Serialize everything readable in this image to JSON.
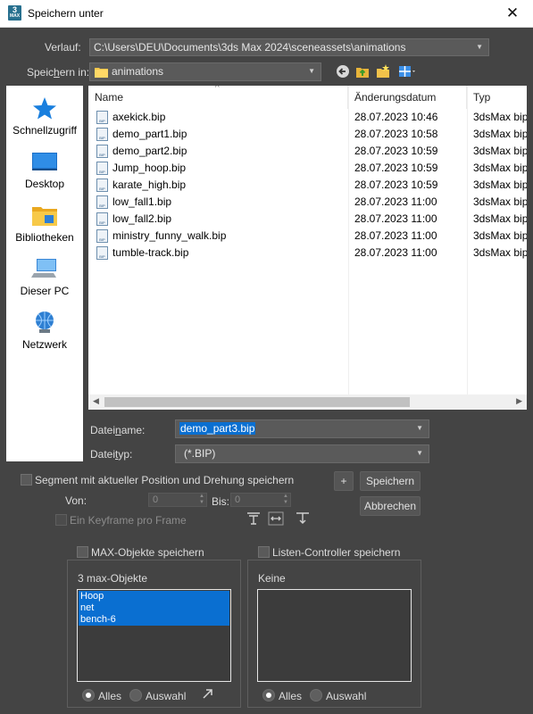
{
  "window": {
    "title": "Speichern unter",
    "app_icon": "3ds-max-icon"
  },
  "history": {
    "label": "Verlauf:",
    "value": "C:\\Users\\DEU\\Documents\\3ds Max 2024\\sceneassets\\animations"
  },
  "save_in": {
    "label_pre": "Speic",
    "label_u": "h",
    "label_post": "ern in:",
    "value": "animations"
  },
  "places": [
    "Schnellzugriff",
    "Desktop",
    "Bibliotheken",
    "Dieser PC",
    "Netzwerk"
  ],
  "columns": {
    "name": "Name",
    "date": "Änderungsdatum",
    "type": "Typ"
  },
  "files": [
    {
      "name": "axekick.bip",
      "date": "28.07.2023 10:46",
      "type": "3dsMax bip"
    },
    {
      "name": "demo_part1.bip",
      "date": "28.07.2023 10:58",
      "type": "3dsMax bip"
    },
    {
      "name": "demo_part2.bip",
      "date": "28.07.2023 10:59",
      "type": "3dsMax bip"
    },
    {
      "name": "Jump_hoop.bip",
      "date": "28.07.2023 10:59",
      "type": "3dsMax bip"
    },
    {
      "name": "karate_high.bip",
      "date": "28.07.2023 10:59",
      "type": "3dsMax bip"
    },
    {
      "name": "low_fall1.bip",
      "date": "28.07.2023 11:00",
      "type": "3dsMax bip"
    },
    {
      "name": "low_fall2.bip",
      "date": "28.07.2023 11:00",
      "type": "3dsMax bip"
    },
    {
      "name": "ministry_funny_walk.bip",
      "date": "28.07.2023 11:00",
      "type": "3dsMax bip"
    },
    {
      "name": "tumble-track.bip",
      "date": "28.07.2023 11:00",
      "type": "3dsMax bip"
    }
  ],
  "filename": {
    "label_pre": "Datei",
    "label_u": "n",
    "label_post": "ame:",
    "value": "demo_part3.bip"
  },
  "filetype": {
    "label_pre": "Datei",
    "label_u": "t",
    "label_post": "yp:",
    "value": "(*.BIP)"
  },
  "segment_checkbox": "Segment mit aktueller Position und Drehung speichern",
  "from": {
    "label": "Von:",
    "value": "0"
  },
  "to": {
    "label": "Bis:",
    "value": "0"
  },
  "keyframe_checkbox": "Ein Keyframe pro Frame",
  "buttons": {
    "plus": "+",
    "save": "Speichern",
    "cancel": "Abbrechen"
  },
  "max_objects_checkbox": "MAX-Objekte speichern",
  "list_controller_checkbox": "Listen-Controller speichern",
  "left_group": {
    "title": "3 max-Objekte",
    "items": [
      "Hoop",
      "net",
      "bench-6"
    ],
    "radio_all": "Alles",
    "radio_selection": "Auswahl"
  },
  "right_group": {
    "title": "Keine",
    "radio_all": "Alles",
    "radio_selection": "Auswahl"
  },
  "colors": {
    "accent": "#0a6fd1",
    "background": "#444444"
  }
}
